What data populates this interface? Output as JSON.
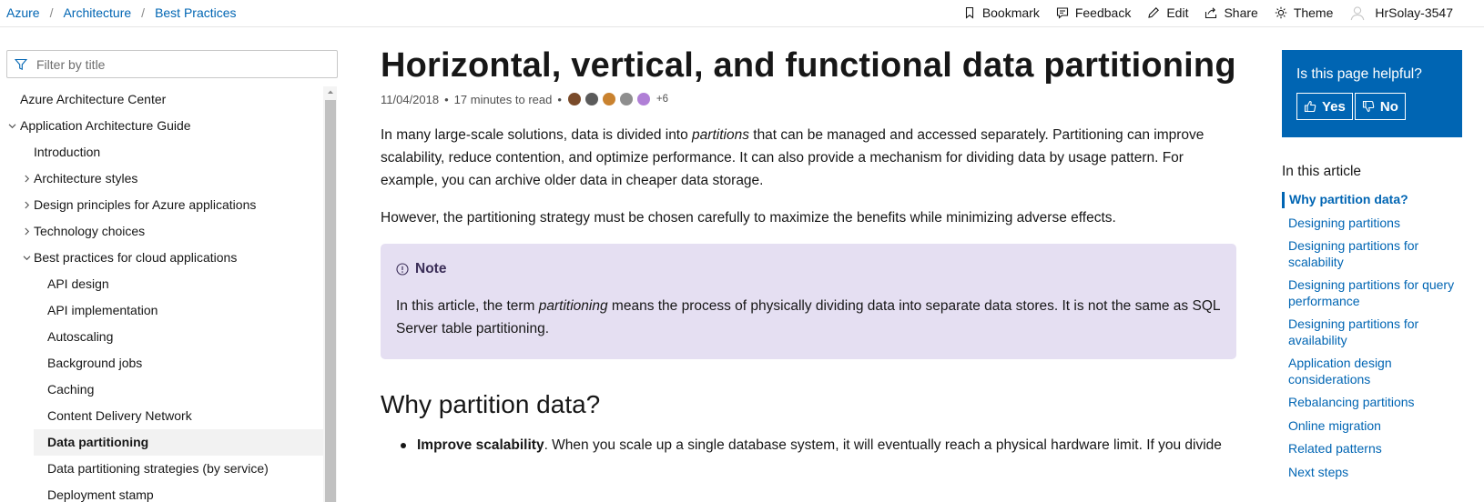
{
  "breadcrumbs": [
    "Azure",
    "Architecture",
    "Best Practices"
  ],
  "topbar": {
    "actions": [
      {
        "label": "Bookmark",
        "icon": "bookmark-icon"
      },
      {
        "label": "Feedback",
        "icon": "feedback-icon"
      },
      {
        "label": "Edit",
        "icon": "pencil-icon"
      },
      {
        "label": "Share",
        "icon": "share-icon"
      },
      {
        "label": "Theme",
        "icon": "sun-icon"
      }
    ],
    "user": "HrSolay-3547"
  },
  "sidebar": {
    "filter_placeholder": "Filter by title",
    "items": [
      {
        "label": "Azure Architecture Center",
        "level": 0,
        "expander": "none"
      },
      {
        "label": "Application Architecture Guide",
        "level": 0,
        "expander": "expanded"
      },
      {
        "label": "Introduction",
        "level": 1,
        "expander": "none"
      },
      {
        "label": "Architecture styles",
        "level": 1,
        "expander": "collapsed"
      },
      {
        "label": "Design principles for Azure applications",
        "level": 1,
        "expander": "collapsed"
      },
      {
        "label": "Technology choices",
        "level": 1,
        "expander": "collapsed"
      },
      {
        "label": "Best practices for cloud applications",
        "level": 1,
        "expander": "expanded"
      },
      {
        "label": "API design",
        "level": 2,
        "expander": "none"
      },
      {
        "label": "API implementation",
        "level": 2,
        "expander": "none"
      },
      {
        "label": "Autoscaling",
        "level": 2,
        "expander": "none"
      },
      {
        "label": "Background jobs",
        "level": 2,
        "expander": "none"
      },
      {
        "label": "Caching",
        "level": 2,
        "expander": "none"
      },
      {
        "label": "Content Delivery Network",
        "level": 2,
        "expander": "none"
      },
      {
        "label": "Data partitioning",
        "level": 2,
        "expander": "none",
        "active": true
      },
      {
        "label": "Data partitioning strategies (by service)",
        "level": 2,
        "expander": "none"
      },
      {
        "label": "Deployment stamp",
        "level": 2,
        "expander": "none"
      }
    ]
  },
  "article": {
    "title": "Horizontal, vertical, and functional data partitioning",
    "date": "11/04/2018",
    "read_time": "17 minutes to read",
    "contributors_more": "+6",
    "contributor_colors": [
      "#7a4b2a",
      "#5b5b5b",
      "#c9822f",
      "#8e8e8e",
      "#b07fd6"
    ],
    "intro_before": "In many large-scale solutions, data is divided into ",
    "intro_em": "partitions",
    "intro_after": " that can be managed and accessed separately. Partitioning can improve scalability, reduce contention, and optimize performance. It can also provide a mechanism for dividing data by usage pattern. For example, you can archive older data in cheaper data storage.",
    "para2": "However, the partitioning strategy must be chosen carefully to maximize the benefits while minimizing adverse effects.",
    "note": {
      "title": "Note",
      "body_before": "In this article, the term ",
      "body_em": "partitioning",
      "body_after": " means the process of physically dividing data into separate data stores. It is not the same as SQL Server table partitioning."
    },
    "h2": "Why partition data?",
    "bullet_bold": "Improve scalability",
    "bullet_text": ". When you scale up a single database system, it will eventually reach a physical hardware limit. If you divide"
  },
  "helpful": {
    "question": "Is this page helpful?",
    "yes": "Yes",
    "no": "No"
  },
  "in_this_article": {
    "title": "In this article",
    "links": [
      "Why partition data?",
      "Designing partitions",
      "Designing partitions for scalability",
      "Designing partitions for query performance",
      "Designing partitions for availability",
      "Application design considerations",
      "Rebalancing partitions",
      "Online migration",
      "Related patterns",
      "Next steps"
    ],
    "current_index": 0
  }
}
